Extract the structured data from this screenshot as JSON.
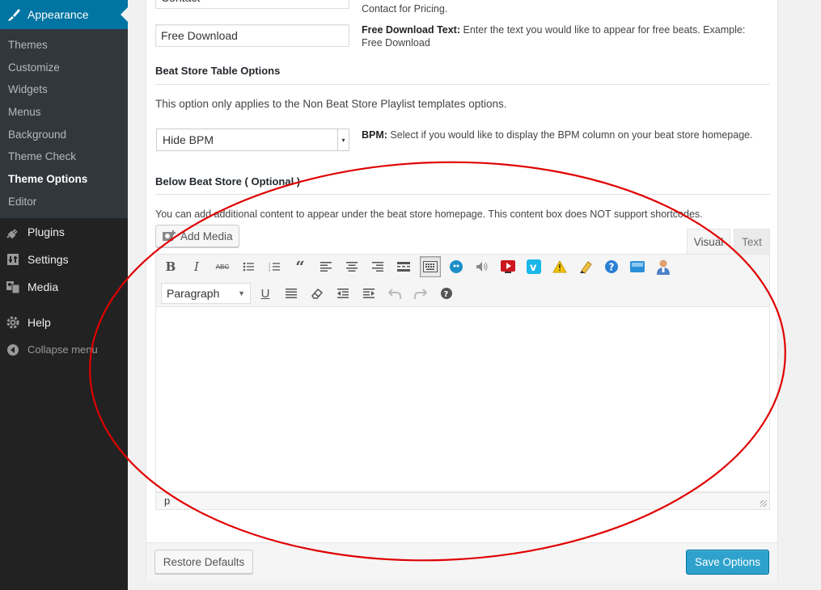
{
  "sidebar": {
    "parent": {
      "label": "Appearance",
      "icon": "paintbrush-icon"
    },
    "submenu": [
      {
        "label": "Themes",
        "current": false
      },
      {
        "label": "Customize",
        "current": false
      },
      {
        "label": "Widgets",
        "current": false
      },
      {
        "label": "Menus",
        "current": false
      },
      {
        "label": "Background",
        "current": false
      },
      {
        "label": "Theme Check",
        "current": false
      },
      {
        "label": "Theme Options",
        "current": true
      },
      {
        "label": "Editor",
        "current": false
      }
    ],
    "items": [
      {
        "label": "Plugins",
        "icon": "plugin-icon"
      },
      {
        "label": "Settings",
        "icon": "settings-icon"
      },
      {
        "label": "Media",
        "icon": "media-icon"
      },
      {
        "label": "Help",
        "icon": "gear-icon"
      },
      {
        "label": "Collapse menu",
        "icon": "collapse-icon"
      }
    ]
  },
  "form": {
    "contact_value": "Contact",
    "contact_desc_tail": "Contact for Pricing.",
    "free_download_value": "Free Download",
    "free_download_desc_label": "Free Download Text:",
    "free_download_desc": " Enter the text you would like to appear for free beats. Example: Free Download",
    "table_heading": "Beat Store Table Options",
    "table_note": "This option only applies to the Non Beat Store Playlist templates options.",
    "bpm_selected": "Hide BPM",
    "bpm_desc_label": "BPM:",
    "bpm_desc": " Select if you would like to display the BPM column on your beat store homepage.",
    "below_heading": "Below Beat Store ( Optional )",
    "below_note": "You can add additional content to appear under the beat store homepage. This content box does NOT support shortcodes."
  },
  "editor": {
    "add_media_label": "Add Media",
    "tab_visual": "Visual",
    "tab_text": "Text",
    "format_selected": "Paragraph",
    "status_path": "p",
    "content": ""
  },
  "buttons": {
    "restore": "Restore Defaults",
    "save": "Save Options"
  },
  "colors": {
    "sidebar_bg": "#222222",
    "active_menu": "#0074a2",
    "primary_button": "#2ea2cc",
    "annotation_ellipse": "#e00000"
  }
}
